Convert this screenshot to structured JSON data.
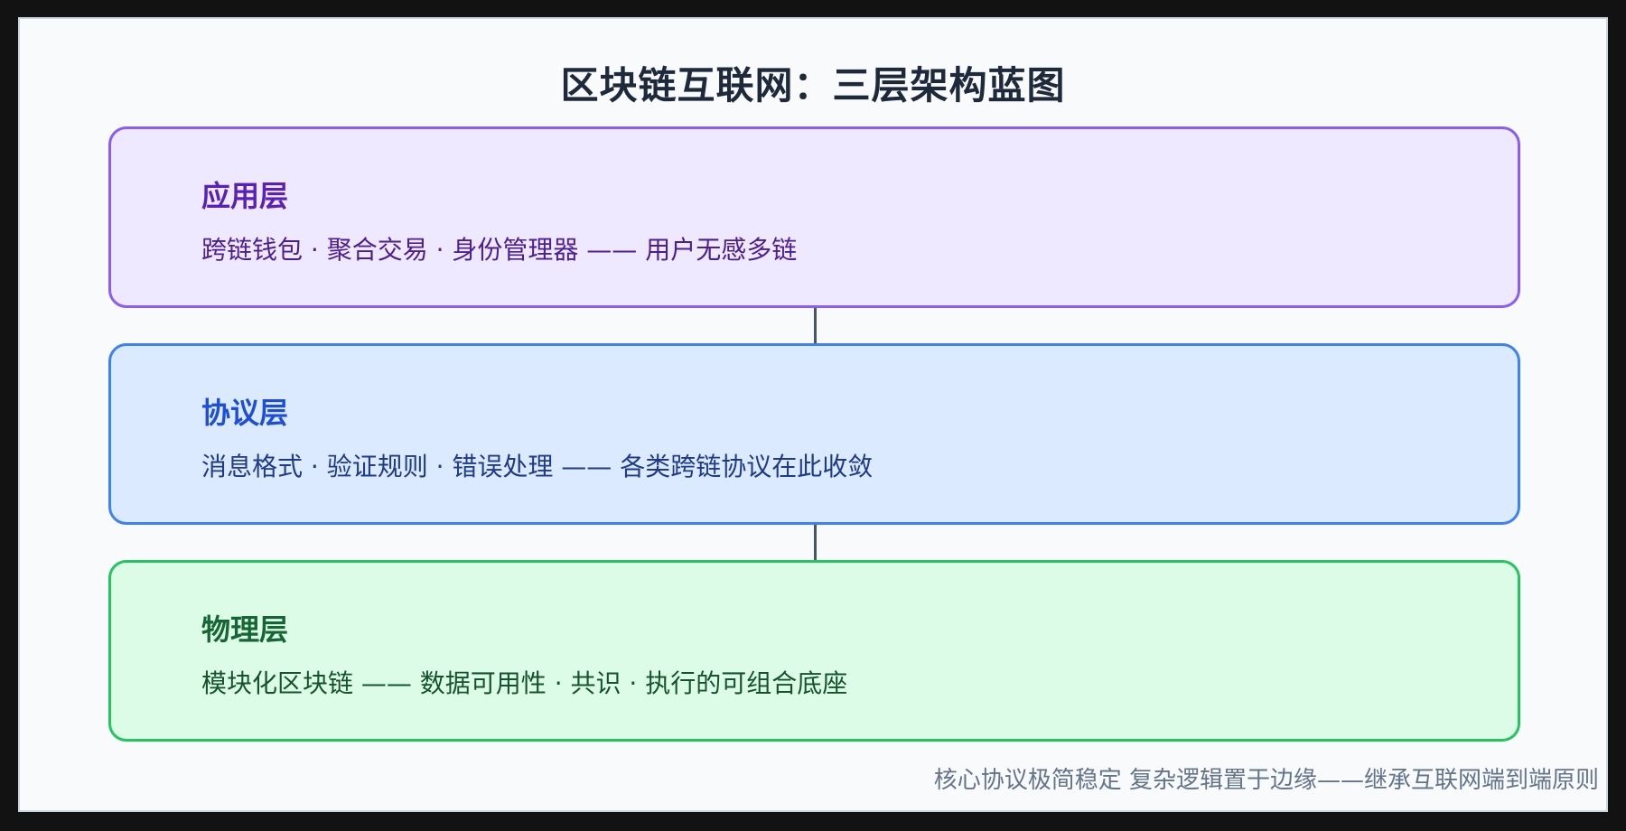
{
  "title": "区块链互联网：三层架构蓝图",
  "layers": [
    {
      "name": "应用层",
      "description": "跨链钱包 · 聚合交易 · 身份管理器 —— 用户无感多链",
      "border_color": "#8b5cf6",
      "fill_color": "#efe9ff"
    },
    {
      "name": "协议层",
      "description": "消息格式 · 验证规则 · 错误处理 —— 各类跨链协议在此收敛",
      "border_color": "#3b82f6",
      "fill_color": "#dbeafe"
    },
    {
      "name": "物理层",
      "description": "模块化区块链 —— 数据可用性 · 共识 · 执行的可组合底座",
      "border_color": "#22c55e",
      "fill_color": "#dcfce7"
    }
  ],
  "footer": "核心协议极简稳定 复杂逻辑置于边缘——继承互联网端到端原则"
}
